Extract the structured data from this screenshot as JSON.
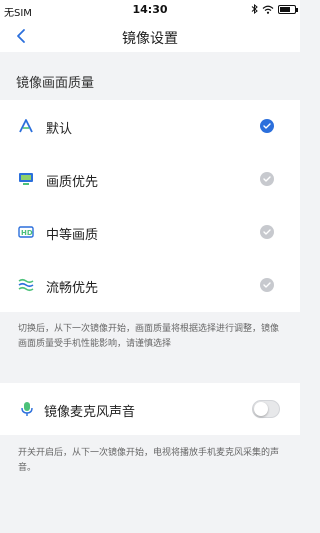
{
  "status_bar": {
    "carrier": "无SIM",
    "time": "14:30",
    "battery_level": 0.7
  },
  "nav": {
    "title": "镜像设置",
    "back_icon": "chevron-left-icon"
  },
  "quality": {
    "section_title": "镜像画面质量",
    "options": [
      {
        "label": "默认",
        "icon": "a-letter-icon",
        "selected": true
      },
      {
        "label": "画质优先",
        "icon": "monitor-icon",
        "selected": false
      },
      {
        "label": "中等画质",
        "icon": "hd-icon",
        "selected": false
      },
      {
        "label": "流畅优先",
        "icon": "waves-icon",
        "selected": false
      }
    ],
    "hint": "切换后，从下一次镜像开始，画面质量将根据选择进行调整，镜像画面质量受手机性能影响，请谨慎选择"
  },
  "mic": {
    "label": "镜像麦克风声音",
    "icon": "microphone-icon",
    "enabled": false,
    "hint": "开关开启后，从下一次镜像开始，电视将播放手机麦克风采集的声音。"
  },
  "colors": {
    "accent": "#2b6fdc",
    "inactive_check": "#c7c9ce",
    "background": "#f2f3f5"
  }
}
